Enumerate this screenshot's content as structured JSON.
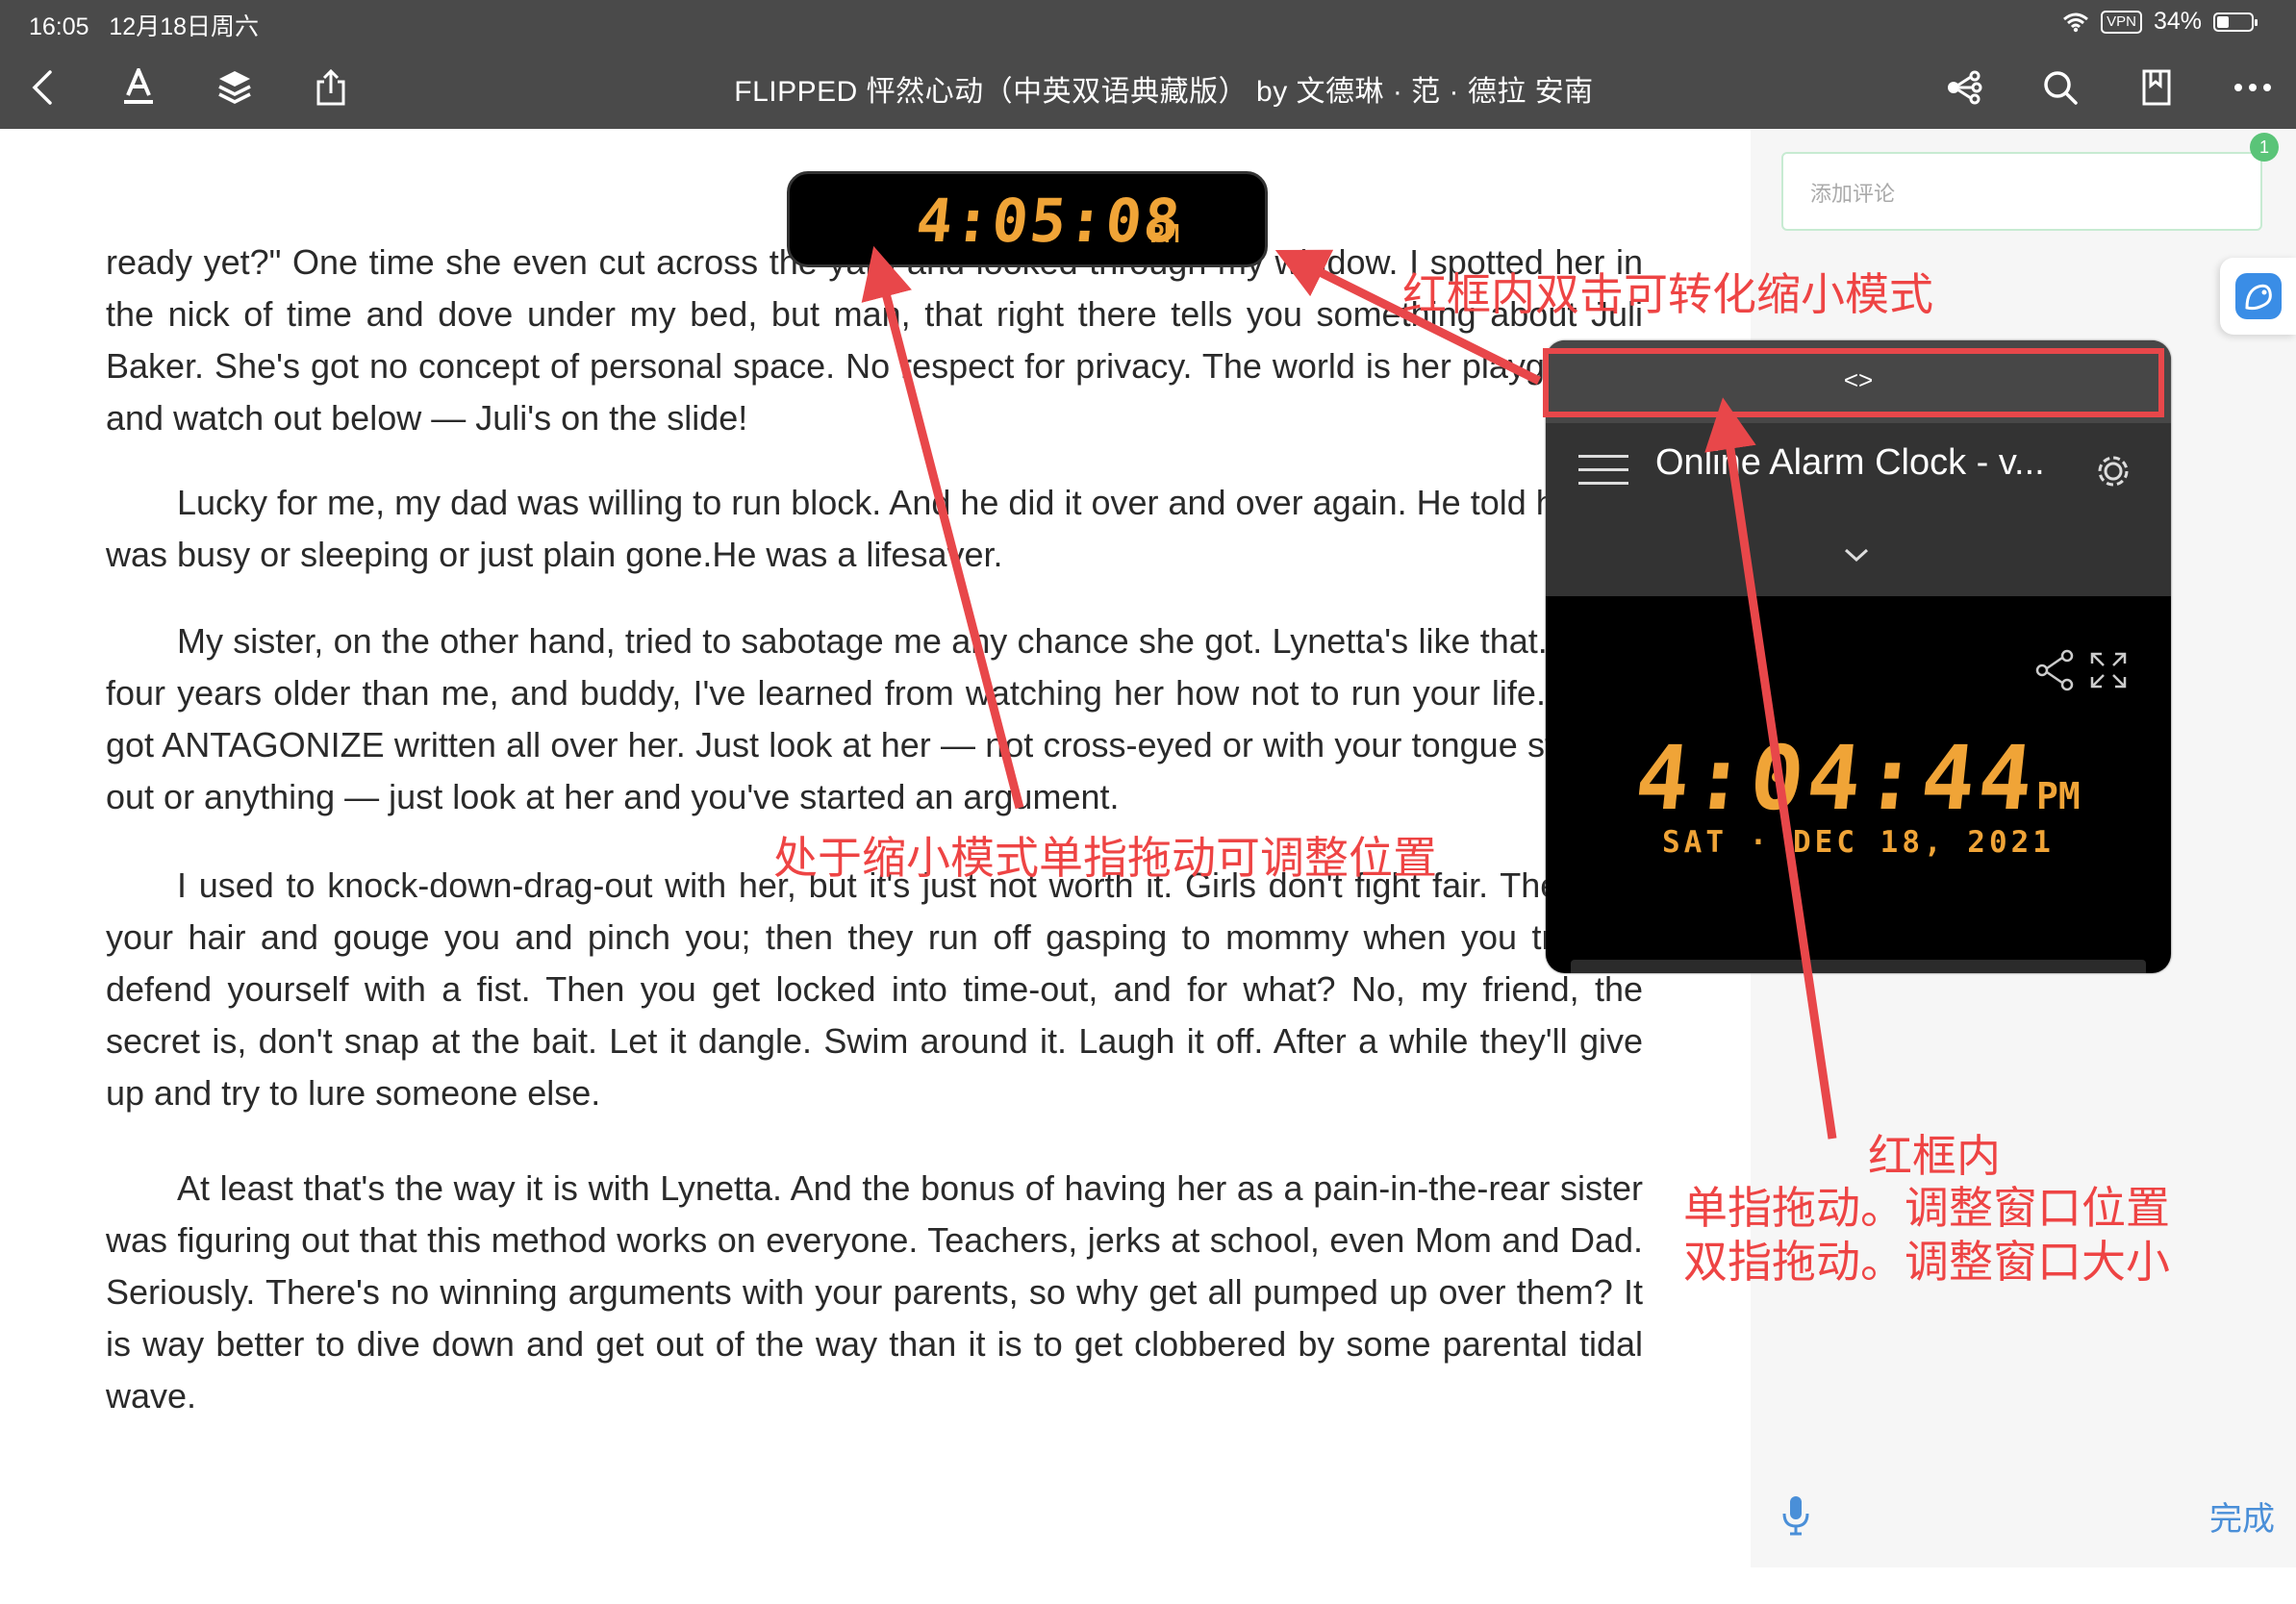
{
  "status_bar": {
    "time": "16:05",
    "date": "12月18日周六",
    "vpn": "VPN",
    "battery_percent": "34%",
    "battery_level": 0.34
  },
  "toolbar": {
    "book_title": "FLIPPED 怦然心动（中英双语典藏版） by 文德琳 · 范 · 德拉 安南",
    "icons": [
      "back-icon",
      "text-style-icon",
      "layers-icon",
      "share-icon",
      "mind-map-icon",
      "search-icon",
      "bookmark-icon",
      "more-icon"
    ]
  },
  "reader": {
    "paragraphs": [
      "ready yet?\" One time she even cut across the yard and looked through my window. I spotted her in the nick of time and dove under my bed, but man, that right there tells you something about Juli Baker. She's got no concept of personal space. No respect for privacy. The world is her playground, and watch out below — Juli's on the slide!",
      "Lucky for me, my dad was willing to run block. And he did it over and over again. He told her I was busy or sleeping or just plain gone.He was a lifesaver.",
      "My sister, on the other hand, tried to sabotage me any chance she got. Lynetta's like that. She's four years older than me, and buddy, I've learned from watching her how not to run your life. She's got ANTAGONIZE written all over her. Just look at her — not cross-eyed or with your tongue sticking out or anything — just look at her and you've started an argument.",
      "I used to knock-down-drag-out with her, but it's just not worth it. Girls don't fight fair. They pull your hair and gouge you and pinch you; then they run off gasping to mommy when you try and defend yourself with a fist. Then you get locked into time-out, and for what? No, my friend, the secret is, don't snap at the bait. Let it dangle. Swim around it. Laugh it off. After a while they'll give up and try to lure someone else.",
      "At least that's the way it is with Lynetta. And the bonus of having her as a pain-in-the-rear sister was figuring out that this method works on everyone. Teachers, jerks at school, even Mom and Dad. Seriously. There's no winning arguments with your parents, so why get all pumped up over them? It is way better to dive down and get out of the way than it is to get clobbered by some parental tidal wave."
    ]
  },
  "side_panel": {
    "comment_placeholder": "添加评论",
    "comment_count": "1",
    "done_label": "完成",
    "mic_icon": "microphone-icon",
    "side_tab_icon": "app-icon"
  },
  "clock_pill": {
    "time": "4:05:08",
    "ampm": "PM"
  },
  "float_window": {
    "handle_label": "<>",
    "title": "Online Alarm Clock - v...",
    "time": "4:04:44",
    "ampm": "PM",
    "date": "SAT · DEC 18, 2021",
    "icons": [
      "hamburger-menu-icon",
      "gear-icon",
      "chevron-down-icon",
      "share-icon",
      "fullscreen-icon"
    ]
  },
  "annotations": {
    "double_tap": "红框内双击可转化缩小模式",
    "drag_compact": "处于缩小模式单指拖动可调整位置",
    "frame_title": "红框内",
    "single_drag": "单指拖动。调整窗口位置",
    "double_drag": "双指拖动。调整窗口大小",
    "color": "#e8474a"
  }
}
